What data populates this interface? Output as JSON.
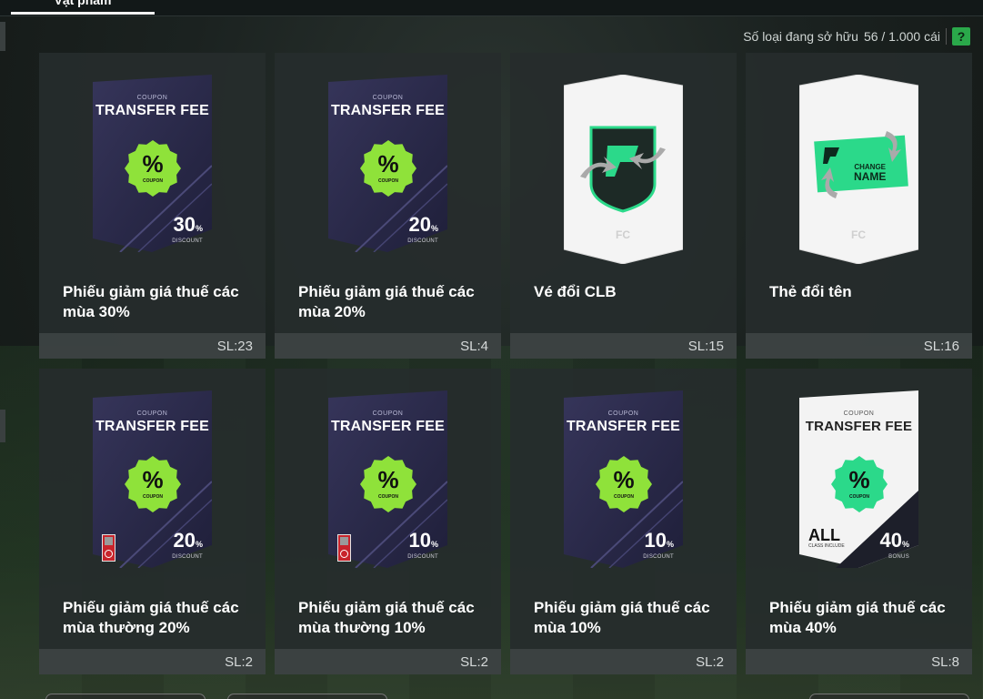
{
  "header": {
    "active_tab": "Vật phẩm"
  },
  "owned_info": {
    "label": "Số loại đang sở hữu",
    "value": "56 / 1.000 cái",
    "help": "?"
  },
  "items": [
    {
      "name": "Phiếu giảm giá thuế các mùa 30%",
      "qty": "SL:23",
      "art": "dark-coupon",
      "coupon_small": "COUPON",
      "coupon_title": "TRANSFER FEE",
      "badge_sub": "COUPON",
      "discount_value": "30",
      "discount_unit": "%",
      "discount_label": "DISCOUNT"
    },
    {
      "name": "Phiếu giảm giá thuế các mùa 20%",
      "qty": "SL:4",
      "art": "dark-coupon",
      "coupon_small": "COUPON",
      "coupon_title": "TRANSFER FEE",
      "badge_sub": "COUPON",
      "discount_value": "20",
      "discount_unit": "%",
      "discount_label": "DISCOUNT"
    },
    {
      "name": "Vé đổi CLB",
      "qty": "SL:15",
      "art": "club-change-card"
    },
    {
      "name": "Thẻ đổi tên",
      "qty": "SL:16",
      "art": "name-change-card",
      "card_small": "CHANGE",
      "card_big": "NAME"
    },
    {
      "name": "Phiếu giảm giá thuế các mùa thường 20%",
      "qty": "SL:2",
      "art": "dark-coupon-restricted",
      "coupon_small": "COUPON",
      "coupon_title": "TRANSFER FEE",
      "badge_sub": "COUPON",
      "discount_value": "20",
      "discount_unit": "%",
      "discount_label": "DISCOUNT"
    },
    {
      "name": "Phiếu giảm giá thuế các mùa thường 10%",
      "qty": "SL:2",
      "art": "dark-coupon-restricted",
      "coupon_small": "COUPON",
      "coupon_title": "TRANSFER FEE",
      "badge_sub": "COUPON",
      "discount_value": "10",
      "discount_unit": "%",
      "discount_label": "DISCOUNT"
    },
    {
      "name": "Phiếu giảm giá thuế các mùa 10%",
      "qty": "SL:2",
      "art": "dark-coupon",
      "coupon_small": "COUPON",
      "coupon_title": "TRANSFER FEE",
      "badge_sub": "COUPON",
      "discount_value": "10",
      "discount_unit": "%",
      "discount_label": "DISCOUNT"
    },
    {
      "name": "Phiếu giảm giá thuế các mùa 40%",
      "qty": "SL:8",
      "art": "white-coupon",
      "coupon_small": "COUPON",
      "coupon_title": "TRANSFER FEE",
      "badge_sub": "COUPON",
      "discount_value": "40",
      "discount_unit": "%",
      "discount_label": "BONUS",
      "class_label": "ALL",
      "class_sub": "CLASS INCLUDE"
    }
  ],
  "colors": {
    "dark_card": "#2a2a48",
    "badge_green": "#8fe23a",
    "accent_green": "#2bd98a",
    "help_green": "#2aa84a"
  }
}
